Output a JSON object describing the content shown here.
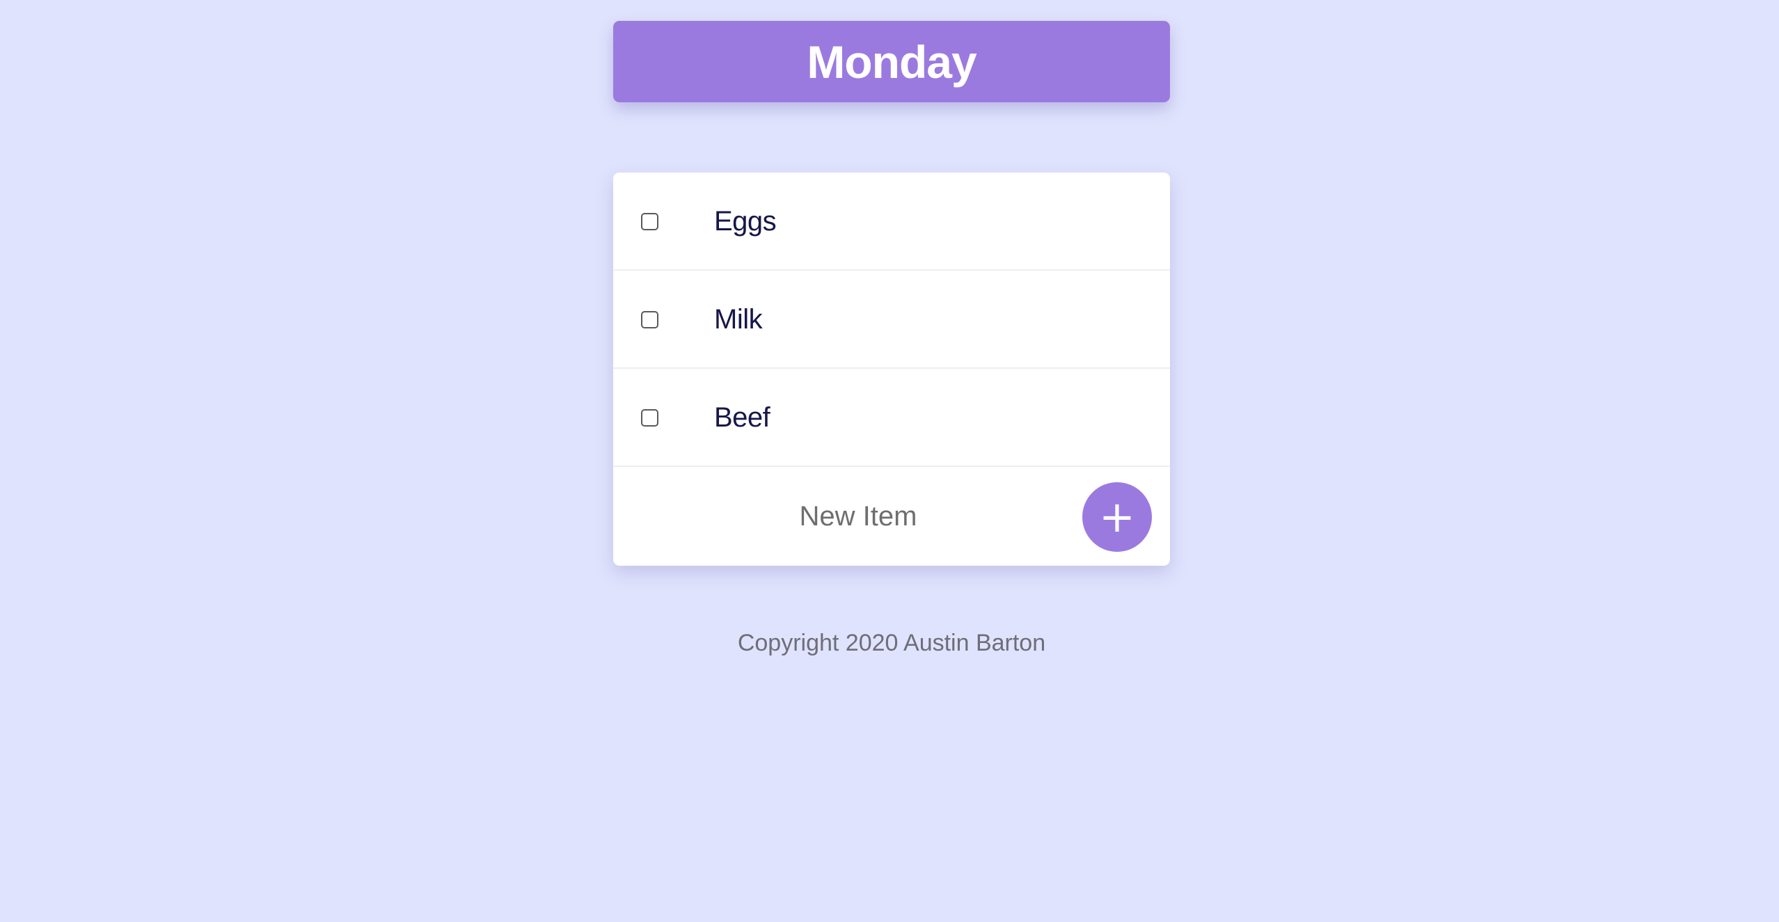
{
  "header": {
    "title": "Monday"
  },
  "list": {
    "items": [
      {
        "label": "Eggs",
        "checked": false
      },
      {
        "label": "Milk",
        "checked": false
      },
      {
        "label": "Beef",
        "checked": false
      }
    ],
    "new_item": {
      "placeholder": "New Item",
      "value": "",
      "add_label": "+"
    }
  },
  "footer": {
    "text": "Copyright 2020 Austin Barton"
  },
  "colors": {
    "background": "#e0e3fd",
    "accent": "#9b7ae0",
    "item_text": "#17174a",
    "muted_text": "#6e6e6e"
  }
}
